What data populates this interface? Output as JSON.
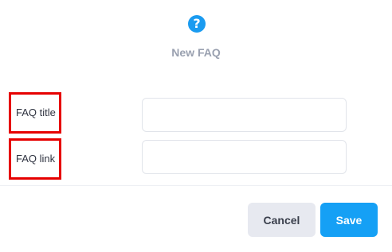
{
  "dialog": {
    "icon": "question-circle-icon",
    "icon_glyph": "?",
    "title": "New FAQ"
  },
  "form": {
    "faq_title": {
      "label": "FAQ title",
      "value": "",
      "placeholder": ""
    },
    "faq_link": {
      "label": "FAQ link",
      "value": "",
      "placeholder": ""
    }
  },
  "actions": {
    "cancel_label": "Cancel",
    "save_label": "Save"
  },
  "colors": {
    "accent": "#1a9bf0",
    "highlight_border": "#e60000",
    "title_text": "#9aa1b0",
    "cancel_bg": "#e7e9f0"
  }
}
